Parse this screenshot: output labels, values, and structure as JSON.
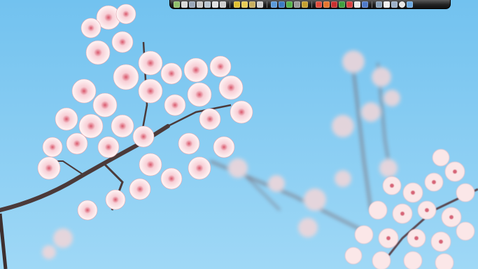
{
  "wallpaper": {
    "subject": "",
    "sky_color": "#7ec8f0"
  },
  "dock": {
    "groups": [
      [
        {
          "name": "system-icon",
          "color": "#8fbf6a"
        },
        {
          "name": "document-icon",
          "color": "#d8d8d8"
        },
        {
          "name": "window-icon",
          "color": "#9aa7b8"
        },
        {
          "name": "folder-icon",
          "color": "#c9c9c9"
        },
        {
          "name": "computer-icon",
          "color": "#b8c4d0"
        },
        {
          "name": "sheet-icon",
          "color": "#e0e0e0"
        },
        {
          "name": "camera-icon",
          "color": "#cfcfcf"
        }
      ],
      [
        {
          "name": "yellow-folder-icon",
          "color": "#e0c030"
        },
        {
          "name": "folder-open-icon",
          "color": "#e7cc55"
        },
        {
          "name": "archive-icon",
          "color": "#c8b060"
        },
        {
          "name": "notes-icon",
          "color": "#d0d0d0"
        }
      ],
      [
        {
          "name": "globe-icon",
          "color": "#5b9ad8"
        },
        {
          "name": "browser-icon",
          "color": "#3c7cc4"
        },
        {
          "name": "photos-icon",
          "color": "#55b24a"
        },
        {
          "name": "settings-icon",
          "color": "#999999"
        },
        {
          "name": "media-icon",
          "color": "#c4a030"
        }
      ],
      [
        {
          "name": "chrome-icon",
          "color": "#e04b3c"
        },
        {
          "name": "firefox-icon",
          "color": "#e5752e"
        },
        {
          "name": "pdf-icon",
          "color": "#c83030"
        },
        {
          "name": "messenger-icon",
          "color": "#40a040"
        },
        {
          "name": "mail-icon",
          "color": "#d94040"
        },
        {
          "name": "calendar-icon",
          "color": "#e8e8e8"
        },
        {
          "name": "recycle-icon",
          "color": "#4f7ac8"
        }
      ],
      [
        {
          "name": "network-icon",
          "color": "#88a0b8"
        },
        {
          "name": "calendar-date-icon",
          "color": "#f0f0f0"
        },
        {
          "name": "battery-icon",
          "color": "#9cb0c8"
        },
        {
          "name": "clock-icon",
          "color": "#e8e8e8"
        },
        {
          "name": "weather-icon",
          "color": "#6aa8e0"
        }
      ]
    ]
  }
}
